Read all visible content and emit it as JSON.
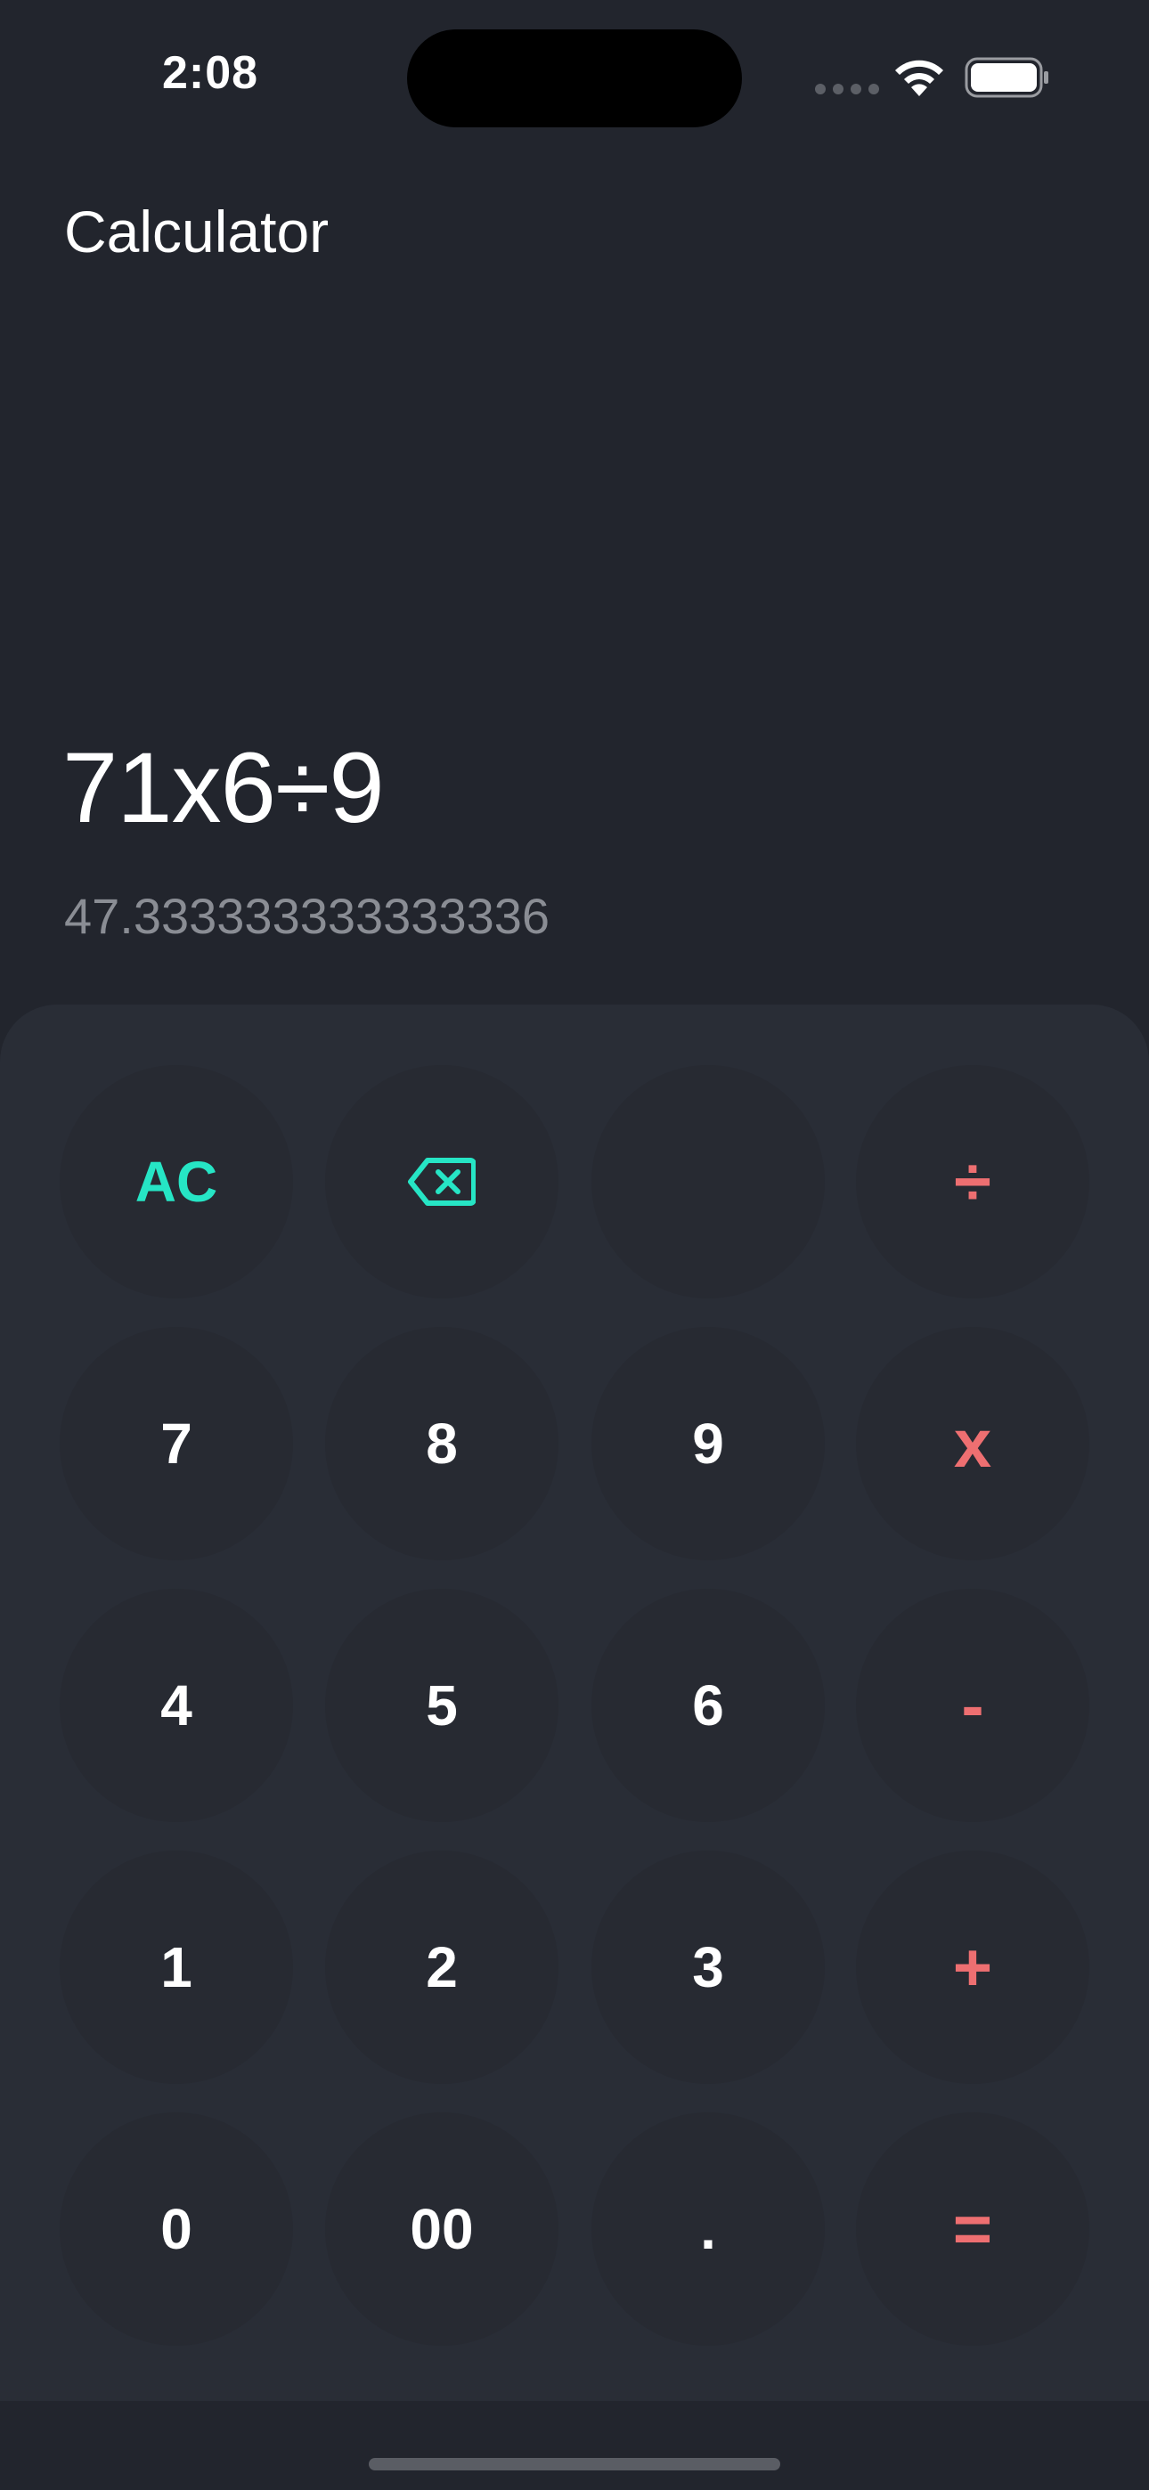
{
  "status_bar": {
    "time": "2:08"
  },
  "header": {
    "title": "Calculator"
  },
  "display": {
    "expression": "71x6÷9",
    "result": "47.333333333333336"
  },
  "keypad": {
    "rows": [
      [
        {
          "label": "AC",
          "kind": "function"
        },
        {
          "label": "",
          "kind": "backspace",
          "icon": "backspace-icon"
        },
        {
          "label": "",
          "kind": "empty"
        },
        {
          "label": "÷",
          "kind": "operator"
        }
      ],
      [
        {
          "label": "7",
          "kind": "digit"
        },
        {
          "label": "8",
          "kind": "digit"
        },
        {
          "label": "9",
          "kind": "digit"
        },
        {
          "label": "x",
          "kind": "operator"
        }
      ],
      [
        {
          "label": "4",
          "kind": "digit"
        },
        {
          "label": "5",
          "kind": "digit"
        },
        {
          "label": "6",
          "kind": "digit"
        },
        {
          "label": "-",
          "kind": "operator"
        }
      ],
      [
        {
          "label": "1",
          "kind": "digit"
        },
        {
          "label": "2",
          "kind": "digit"
        },
        {
          "label": "3",
          "kind": "digit"
        },
        {
          "label": "+",
          "kind": "operator"
        }
      ],
      [
        {
          "label": "0",
          "kind": "digit"
        },
        {
          "label": "00",
          "kind": "digit"
        },
        {
          "label": ".",
          "kind": "digit"
        },
        {
          "label": "=",
          "kind": "operator"
        }
      ]
    ]
  },
  "colors": {
    "background": "#22252d",
    "keypad_background": "#292d36",
    "key_background": "#272a32",
    "function_accent": "#26e5c5",
    "operator_accent": "#ee6f71",
    "result_text": "#8a8d94"
  }
}
